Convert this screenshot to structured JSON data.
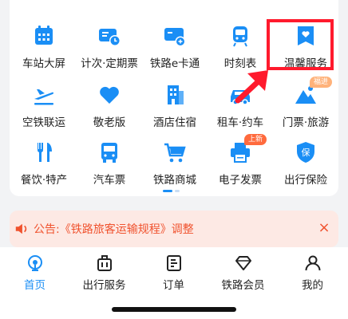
{
  "colors": {
    "primary": "#1a8ef5",
    "highlight": "#ff1a2d",
    "notice": "#f0522e"
  },
  "grid": [
    {
      "label": "车站大屏",
      "icon": "station-screen-icon"
    },
    {
      "label": "计次·定期票",
      "icon": "ticket-calendar-icon"
    },
    {
      "label": "铁路e卡通",
      "icon": "e-card-icon"
    },
    {
      "label": "时刻表",
      "icon": "train-icon"
    },
    {
      "label": "温馨服务",
      "icon": "heart-bag-icon"
    },
    {
      "label": "空铁联运",
      "icon": "airplane-icon"
    },
    {
      "label": "敬老版",
      "icon": "heart-icon"
    },
    {
      "label": "酒店住宿",
      "icon": "hotel-icon"
    },
    {
      "label": "租车·约车",
      "icon": "car-icon"
    },
    {
      "label": "门票·旅游",
      "icon": "mountain-icon",
      "badge": "福进"
    },
    {
      "label": "餐饮·特产",
      "icon": "fork-knife-icon"
    },
    {
      "label": "汽车票",
      "icon": "bus-icon"
    },
    {
      "label": "铁路商城",
      "icon": "cart-icon"
    },
    {
      "label": "电子发票",
      "icon": "printer-icon",
      "badge": "上新"
    },
    {
      "label": "出行保险",
      "icon": "insurance-shield-icon",
      "icon_text": "保"
    }
  ],
  "notice": {
    "text": "公告:《铁路旅客运输规程》调整",
    "icon": "speaker-icon",
    "close": "×"
  },
  "tabs": [
    {
      "label": "首页",
      "icon": "home-icon"
    },
    {
      "label": "出行服务",
      "icon": "luggage-icon"
    },
    {
      "label": "订单",
      "icon": "order-icon"
    },
    {
      "label": "铁路会员",
      "icon": "diamond-icon"
    },
    {
      "label": "我的",
      "icon": "user-icon"
    }
  ]
}
